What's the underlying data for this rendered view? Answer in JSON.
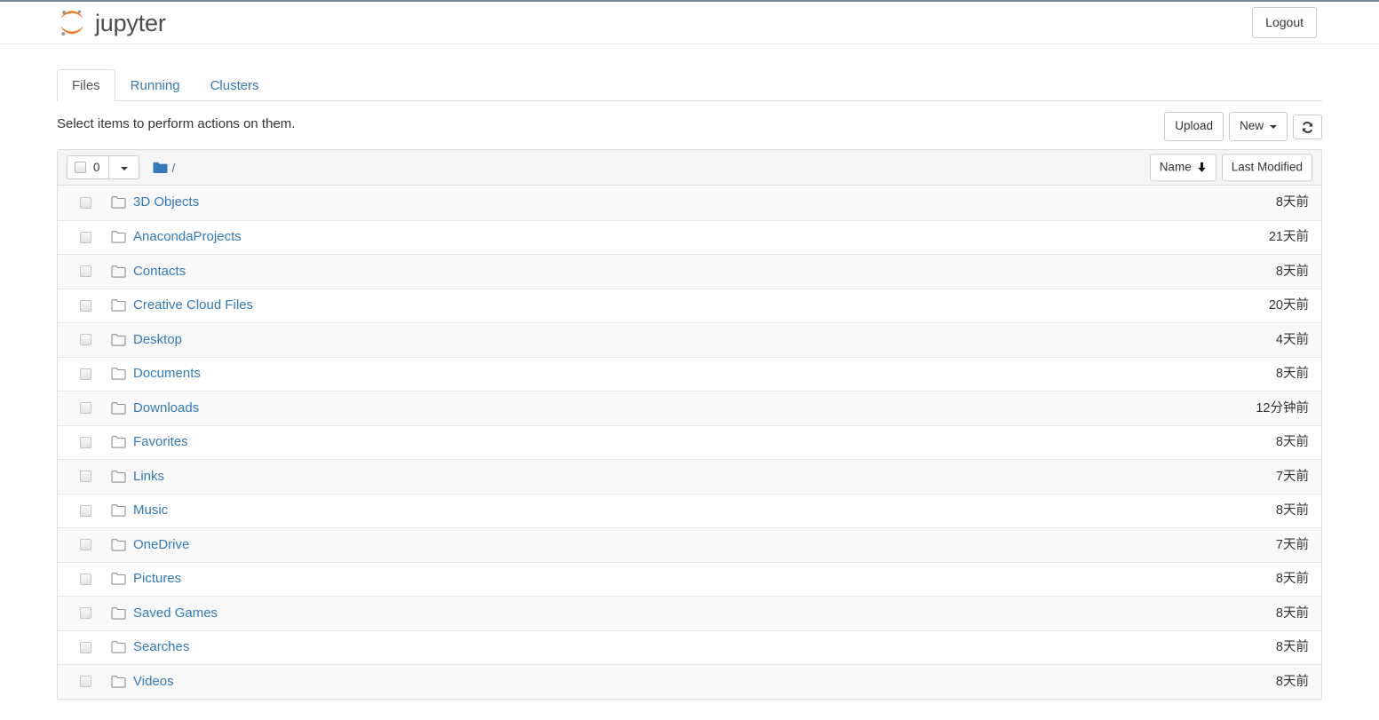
{
  "header": {
    "brand": "jupyter",
    "logo_icon": "jupyter-logo",
    "logout_label": "Logout",
    "accent_color": "#f37726"
  },
  "tabs": [
    {
      "label": "Files",
      "active": true
    },
    {
      "label": "Running",
      "active": false
    },
    {
      "label": "Clusters",
      "active": false
    }
  ],
  "actions": {
    "select_hint": "Select items to perform actions on them.",
    "upload_label": "Upload",
    "new_label": "New",
    "new_caret_icon": "caret-down-icon",
    "refresh_icon": "refresh-icon"
  },
  "list_header": {
    "selected_count": "0",
    "select_checkbox_icon": "checkbox-unchecked-icon",
    "select_caret_icon": "caret-down-icon",
    "breadcrumb_folder_icon": "folder-filled-icon",
    "breadcrumb_path": "/",
    "sort_name_label": "Name",
    "sort_name_icon": "arrow-down-icon",
    "sort_modified_label": "Last Modified"
  },
  "files": [
    {
      "name": "3D Objects",
      "modified": "8天前",
      "icon": "folder-icon"
    },
    {
      "name": "AnacondaProjects",
      "modified": "21天前",
      "icon": "folder-icon"
    },
    {
      "name": "Contacts",
      "modified": "8天前",
      "icon": "folder-icon"
    },
    {
      "name": "Creative Cloud Files",
      "modified": "20天前",
      "icon": "folder-icon"
    },
    {
      "name": "Desktop",
      "modified": "4天前",
      "icon": "folder-icon"
    },
    {
      "name": "Documents",
      "modified": "8天前",
      "icon": "folder-icon"
    },
    {
      "name": "Downloads",
      "modified": "12分钟前",
      "icon": "folder-icon"
    },
    {
      "name": "Favorites",
      "modified": "8天前",
      "icon": "folder-icon"
    },
    {
      "name": "Links",
      "modified": "7天前",
      "icon": "folder-icon"
    },
    {
      "name": "Music",
      "modified": "8天前",
      "icon": "folder-icon"
    },
    {
      "name": "OneDrive",
      "modified": "7天前",
      "icon": "folder-icon"
    },
    {
      "name": "Pictures",
      "modified": "8天前",
      "icon": "folder-icon"
    },
    {
      "name": "Saved Games",
      "modified": "8天前",
      "icon": "folder-icon"
    },
    {
      "name": "Searches",
      "modified": "8天前",
      "icon": "folder-icon"
    },
    {
      "name": "Videos",
      "modified": "8天前",
      "icon": "folder-icon"
    }
  ],
  "colors": {
    "link": "#337ab7",
    "orange": "#f37726",
    "border": "#dddddd",
    "header_bg": "#f5f5f5",
    "stripe": "#f9f9f9"
  }
}
